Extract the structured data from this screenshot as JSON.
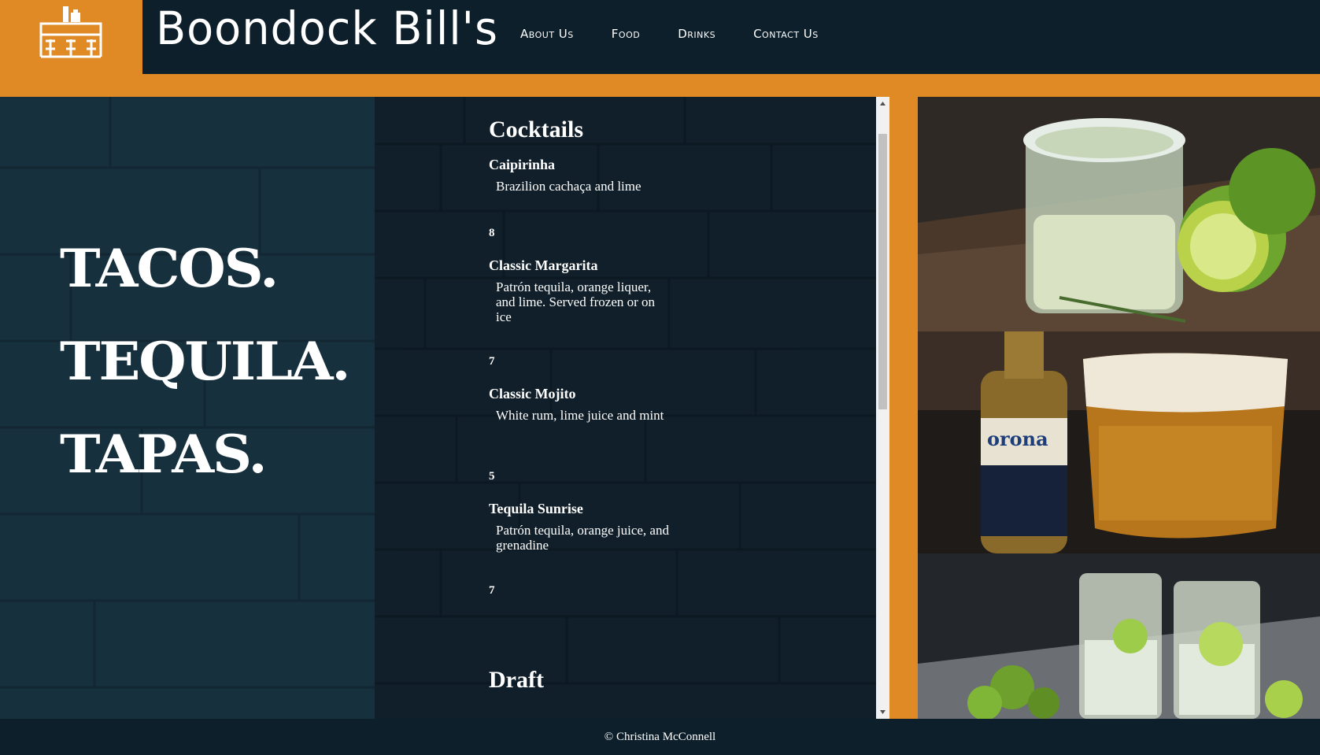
{
  "header": {
    "title": "Boondock Bill's",
    "logo_icon": "bar-counter-icon",
    "nav": [
      {
        "label": "About Us"
      },
      {
        "label": "Food"
      },
      {
        "label": "Drinks"
      },
      {
        "label": "Contact Us"
      }
    ]
  },
  "hero": {
    "words": [
      "TACOS.",
      "TEQUILA.",
      "TAPAS."
    ]
  },
  "menu": {
    "section_cocktails": "Cocktails",
    "items": [
      {
        "name": "Caipirinha",
        "desc": "Brazilion cachaça and lime",
        "price": "8"
      },
      {
        "name": "Classic Margarita",
        "desc": "Patrón tequila, orange liquer, and lime. Served frozen or on ice",
        "price": "7"
      },
      {
        "name": "Classic Mojito",
        "desc": "White rum, lime juice and mint",
        "price": "5"
      },
      {
        "name": "Tequila Sunrise",
        "desc": "Patrón tequila, orange juice, and grenadine",
        "price": "7"
      }
    ],
    "section_draft": "Draft"
  },
  "footer": {
    "text": "© Christina McConnell"
  },
  "colors": {
    "accent": "#df8a24",
    "navy": "#0d1f2b"
  }
}
